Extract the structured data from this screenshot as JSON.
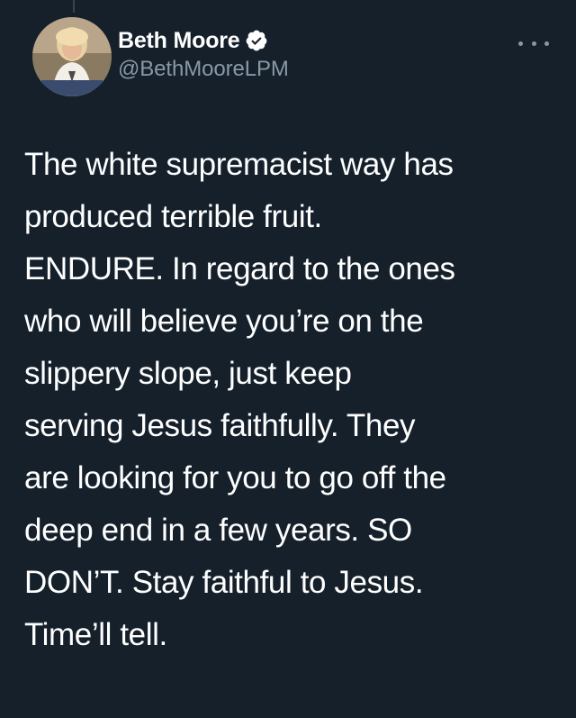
{
  "author": {
    "display_name": "Beth Moore",
    "handle": "@BethMooreLPM",
    "verified": true,
    "avatar_icon": "profile-photo"
  },
  "more_icon": "more-horizontal-icon",
  "tweet": {
    "lines": [
      "The white supremacist way has",
      "produced terrible fruit.",
      "ENDURE. In regard to the ones",
      "who will believe you’re on the",
      "slippery slope, just keep",
      "serving Jesus faithfully. They",
      "are looking for you to go off the",
      "deep end in a few years. SO",
      "DON’T. Stay faithful to Jesus.",
      "Time’ll tell."
    ]
  },
  "colors": {
    "background": "#15202b",
    "text": "#ffffff",
    "secondary": "#8899a6",
    "verified": "#ffffff"
  }
}
